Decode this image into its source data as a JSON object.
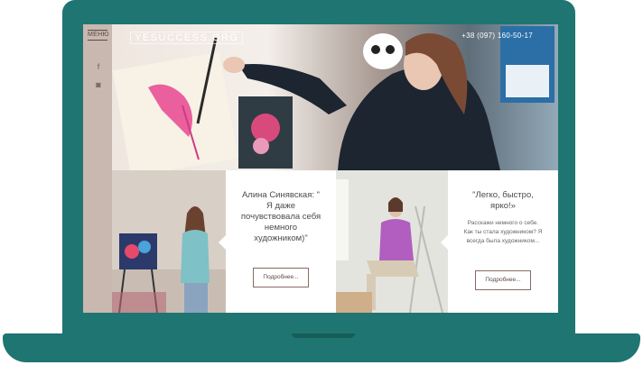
{
  "site": {
    "logo": "YESUCCESS.ORG",
    "phone": "+38 (097) 160-50-17"
  },
  "sidebar": {
    "menu_label": "МЕНЮ",
    "social": [
      {
        "icon": "facebook-icon",
        "glyph": "f"
      },
      {
        "icon": "instagram-icon",
        "glyph": "◙"
      }
    ]
  },
  "cards": [
    {
      "quote": "Алина Синявская: \" Я даже почувствовала себя немного художником)\"",
      "desc": "",
      "button": "Подробнее..."
    },
    {
      "quote": "\"Легко, быстро, ярко!»",
      "desc": "Расскажи немного о себе. Как ты стала художником? Я всегда была художником...",
      "button": "Подробнее..."
    }
  ],
  "colors": {
    "frame": "#1f7572",
    "sidebar": "#c9b8b0",
    "text": "#4b4b4b",
    "button_border": "#8a6a66"
  }
}
